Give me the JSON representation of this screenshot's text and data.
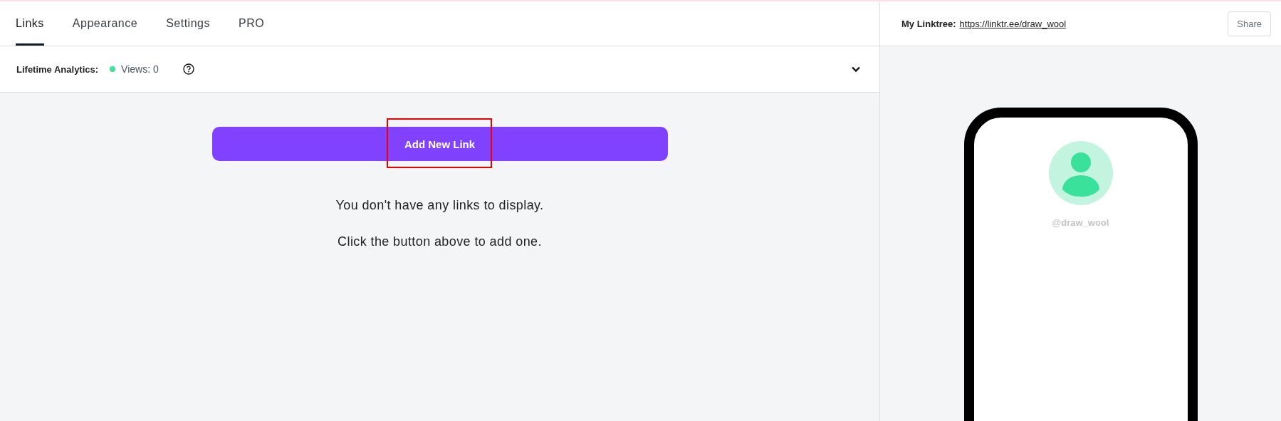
{
  "tabs": [
    {
      "label": "Links",
      "selected": true
    },
    {
      "label": "Appearance",
      "selected": false
    },
    {
      "label": "Settings",
      "selected": false
    },
    {
      "label": "PRO",
      "selected": false
    }
  ],
  "analytics": {
    "label": "Lifetime Analytics:",
    "views": "Views: 0",
    "expanded": false
  },
  "add_button": {
    "label": "Add New Link",
    "highlighted": true
  },
  "empty_messages": [
    "You don't have any links to display.",
    "Click the button above to add one."
  ],
  "preview": {
    "label": "My Linktree:",
    "url": "https://linktr.ee/draw_wool",
    "share": "Share",
    "username": "@draw_wool"
  }
}
